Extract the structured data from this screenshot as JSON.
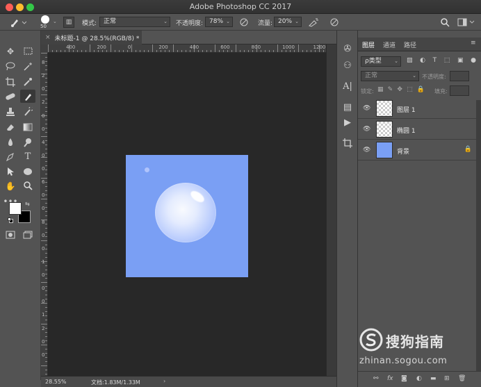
{
  "window": {
    "title": "Adobe Photoshop CC 2017"
  },
  "options_bar": {
    "brush_size": "50",
    "mode_label": "模式:",
    "mode_value": "正常",
    "opacity_label": "不透明度:",
    "opacity_value": "78%",
    "flow_label": "流量:",
    "flow_value": "20%"
  },
  "document": {
    "tab_title": "未标题-1 @ 28.5%(RGB/8) *",
    "close_glyph": "×",
    "ruler_h_ticks": [
      "400",
      "200",
      "0",
      "200",
      "400",
      "600",
      "800",
      "1000",
      "1200"
    ],
    "ruler_v_ticks": [
      "8",
      "2",
      "0",
      "2",
      "0",
      "0",
      "4",
      "0",
      "0",
      "6",
      "0",
      "0",
      "8",
      "0",
      "0",
      "1",
      "0",
      "0",
      "0",
      "1",
      "2",
      "0",
      "0"
    ],
    "zoom": "28.55%",
    "doc_info": "文档:1.83M/1.33M",
    "status_arrow": "›"
  },
  "colors": {
    "canvas_fill": "#7a9ff4",
    "foreground": "#ffffff",
    "background": "#000000",
    "workspace": "#282828"
  },
  "layers_panel": {
    "tabs": [
      "图层",
      "通道",
      "路径"
    ],
    "filter_label": "ρ类型",
    "blend_mode": "正常",
    "opacity_label": "不透明度:",
    "lock_label": "锁定:",
    "fill_label": "填充:",
    "layers": [
      {
        "name": "图层 1",
        "thumb": "transparent",
        "locked": false
      },
      {
        "name": "椭圆 1",
        "thumb": "transparent",
        "locked": false
      },
      {
        "name": "背景",
        "thumb": "#7a9ff4",
        "locked": true
      }
    ]
  },
  "watermark": {
    "brand": "搜狗指南",
    "url": "zhinan.sogou.com"
  }
}
